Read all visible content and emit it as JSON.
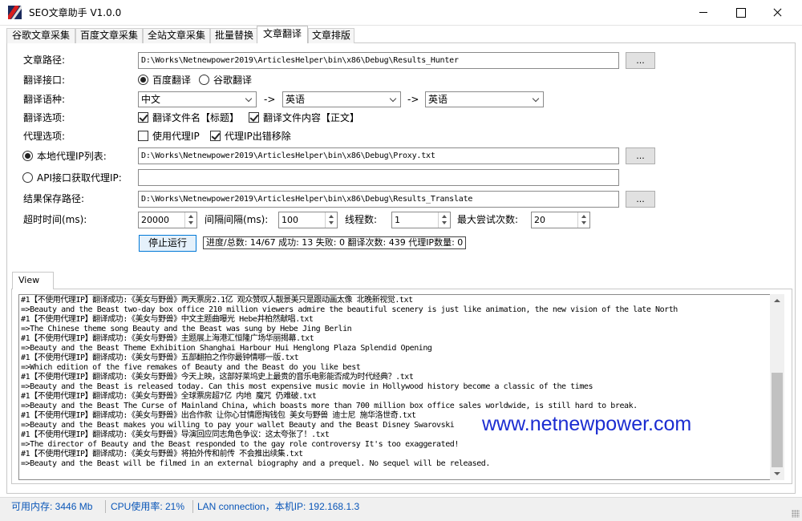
{
  "window": {
    "title": "SEO文章助手 V1.0.0",
    "icon": "app-logo-icon"
  },
  "tabs": [
    {
      "label": "谷歌文章采集",
      "active": false
    },
    {
      "label": "百度文章采集",
      "active": false
    },
    {
      "label": "全站文章采集",
      "active": false
    },
    {
      "label": "批量替换",
      "active": false
    },
    {
      "label": "文章翻译",
      "active": true
    },
    {
      "label": "文章排版",
      "active": false
    }
  ],
  "form": {
    "article_path_label": "文章路径:",
    "article_path_value": "D:\\Works\\Netnewpower2019\\ArticlesHelper\\bin\\x86\\Debug\\Results_Hunter",
    "browse_label": "...",
    "api_label": "翻译接口:",
    "api_baidu": "百度翻译",
    "api_google": "谷歌翻译",
    "lang_label": "翻译语种:",
    "lang_from": "中文",
    "lang_mid": "英语",
    "lang_to": "英语",
    "lang_arrow": "->",
    "translate_options_label": "翻译选项:",
    "opt_filename": "翻译文件名【标题】",
    "opt_content": "翻译文件内容【正文】",
    "proxy_options_label": "代理选项:",
    "use_proxy": "使用代理IP",
    "proxy_error_remove": "代理IP出错移除",
    "local_proxy_label": "本地代理IP列表:",
    "local_proxy_value": "D:\\Works\\Netnewpower2019\\ArticlesHelper\\bin\\x86\\Debug\\Proxy.txt",
    "api_proxy_label": "API接口获取代理IP:",
    "api_proxy_value": "",
    "save_path_label": "结果保存路径:",
    "save_path_value": "D:\\Works\\Netnewpower2019\\ArticlesHelper\\bin\\x86\\Debug\\Results_Translate",
    "timeout_label": "超时时间(ms):",
    "timeout_value": "20000",
    "interval_label": "间隔间隔(ms):",
    "interval_value": "100",
    "threads_label": "线程数:",
    "threads_value": "1",
    "max_retry_label": "最大尝试次数:",
    "max_retry_value": "20",
    "stop_button": "停止运行",
    "progress_text": "进度/总数: 14/67 成功: 13 失败: 0 翻译次数: 439 代理IP数量: 0"
  },
  "view": {
    "tab_label": "View",
    "lines": [
      "#1【不使用代理IP】翻译成功:《美女与野兽》两天票房2.1亿 观众赞叹人靓景美只是跟动画太像 北晚新视觉.txt",
      "=>Beauty and the Beast two-day box office 210 million viewers admire the beautiful scenery is just like animation, the new vision of the late North",
      "#1【不使用代理IP】翻译成功:《美女与野兽》中文主题曲曝光 Hebe井柏然献唱.txt",
      "=>The Chinese theme song Beauty and the Beast was sung by Hebe Jing Berlin",
      "#1【不使用代理IP】翻译成功:《美女与野兽》主题展上海港汇恒隆广场华丽揭幕.txt",
      "=>Beauty and the Beast Theme Exhibition Shanghai Harbour Hui Henglong Plaza Splendid Opening",
      "#1【不使用代理IP】翻译成功:《美女与野兽》五部翻拍之作你最钟情哪一版.txt",
      "=>Which edition of the five remakes of Beauty and the Beast do you like best",
      "#1【不使用代理IP】翻译成功:《美女与野兽》今天上映，这部好莱坞史上最贵的音乐电影能否成为时代经典？.txt",
      "=>Beauty and the Beast is released today. Can this most expensive music movie in Hollywood history become a classic of the times",
      "#1【不使用代理IP】翻译成功:《美女与野兽》全球票房超7亿 内地 魔咒 仍难破.txt",
      "=>Beauty and the Beast The Curse of Mainland China, which boasts more than 700 million box office sales worldwide, is still hard to break.",
      "#1【不使用代理IP】翻译成功:《美女与野兽》出合作款 让你心甘情愿掏钱包 美女与野兽 迪士尼 施华洛世奇.txt",
      "=>Beauty and the Beast makes you willing to pay your wallet Beauty and the Beast Disney Swarovski",
      "#1【不使用代理IP】翻译成功:《美女与野兽》导演回应同志角色争议：这太夸张了！.txt",
      "=>The director of Beauty and the Beast responded to the gay role controversy It's too exaggerated!",
      "#1【不使用代理IP】翻译成功:《美女与野兽》将拍外传和前传 不会推出续集.txt",
      "=>Beauty and the Beast will be filmed in an external biography and a prequel. No sequel will be released."
    ]
  },
  "watermark": "www.netnewpower.com",
  "status": {
    "memory": "可用内存: 3446 Mb",
    "cpu": "CPU使用率: 21%",
    "network": "LAN connection，本机IP: 192.168.1.3"
  },
  "colors": {
    "status_text": "#0a56b8",
    "watermark": "#1b2cd1",
    "focus_border": "#0078d7"
  }
}
